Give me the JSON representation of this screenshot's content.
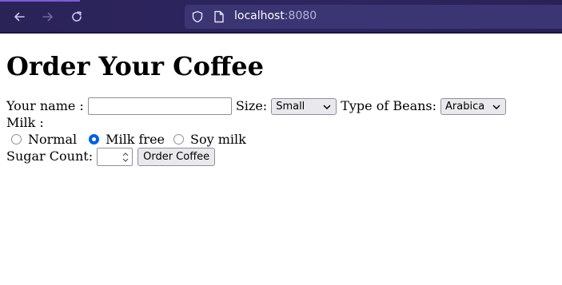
{
  "browser": {
    "url_host": "localhost",
    "url_port": ":8080"
  },
  "page": {
    "title": "Order Your Coffee",
    "name_label": "Your name :",
    "name_value": "",
    "size_label": "Size:",
    "size_selected": "Small",
    "beans_label": "Type of Beans:",
    "beans_selected": "Arabica",
    "milk_label": "Milk :",
    "milk_options": [
      {
        "label": "Normal",
        "checked": false
      },
      {
        "label": "Milk free",
        "checked": true
      },
      {
        "label": "Soy milk",
        "checked": false
      }
    ],
    "sugar_label": "Sugar Count:",
    "sugar_value": "",
    "order_button": "Order Coffee"
  }
}
